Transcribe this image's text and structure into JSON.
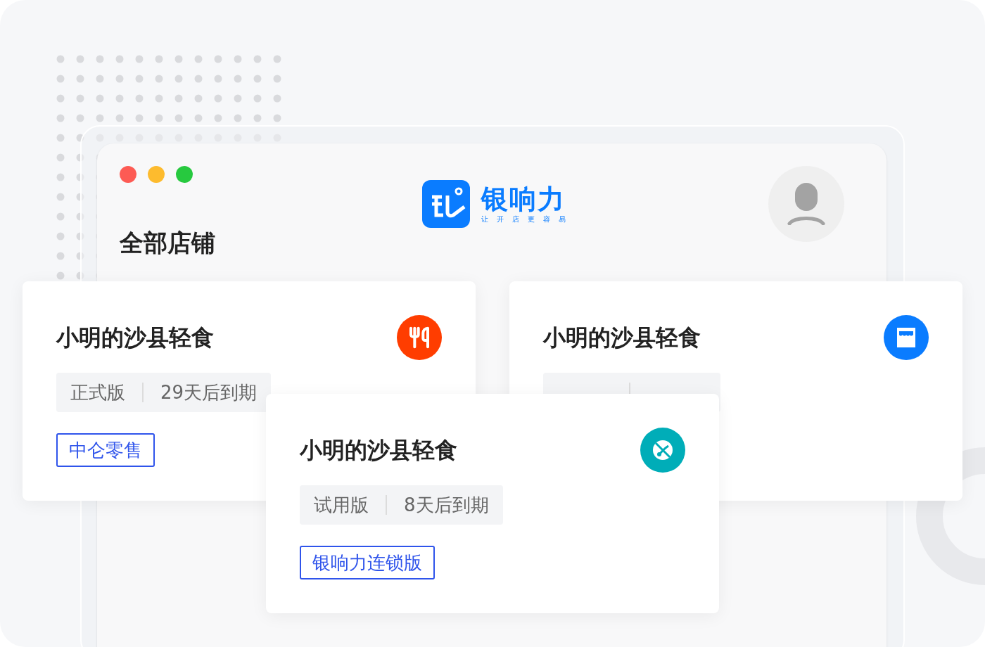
{
  "window": {
    "title": "全部店铺"
  },
  "logo": {
    "name": "银响力",
    "slogan": "让开店更容易"
  },
  "stores": [
    {
      "name": "小明的沙县轻食",
      "kind": "restaurant",
      "edition": "正式版",
      "expiry": "29天后到期",
      "tag": "中仑零售"
    },
    {
      "name": "小明的沙县轻食",
      "kind": "shop"
    },
    {
      "name": "小明的沙县轻食",
      "kind": "leisure",
      "edition": "试用版",
      "expiry": "8天后到期",
      "tag": "银响力连锁版"
    }
  ]
}
